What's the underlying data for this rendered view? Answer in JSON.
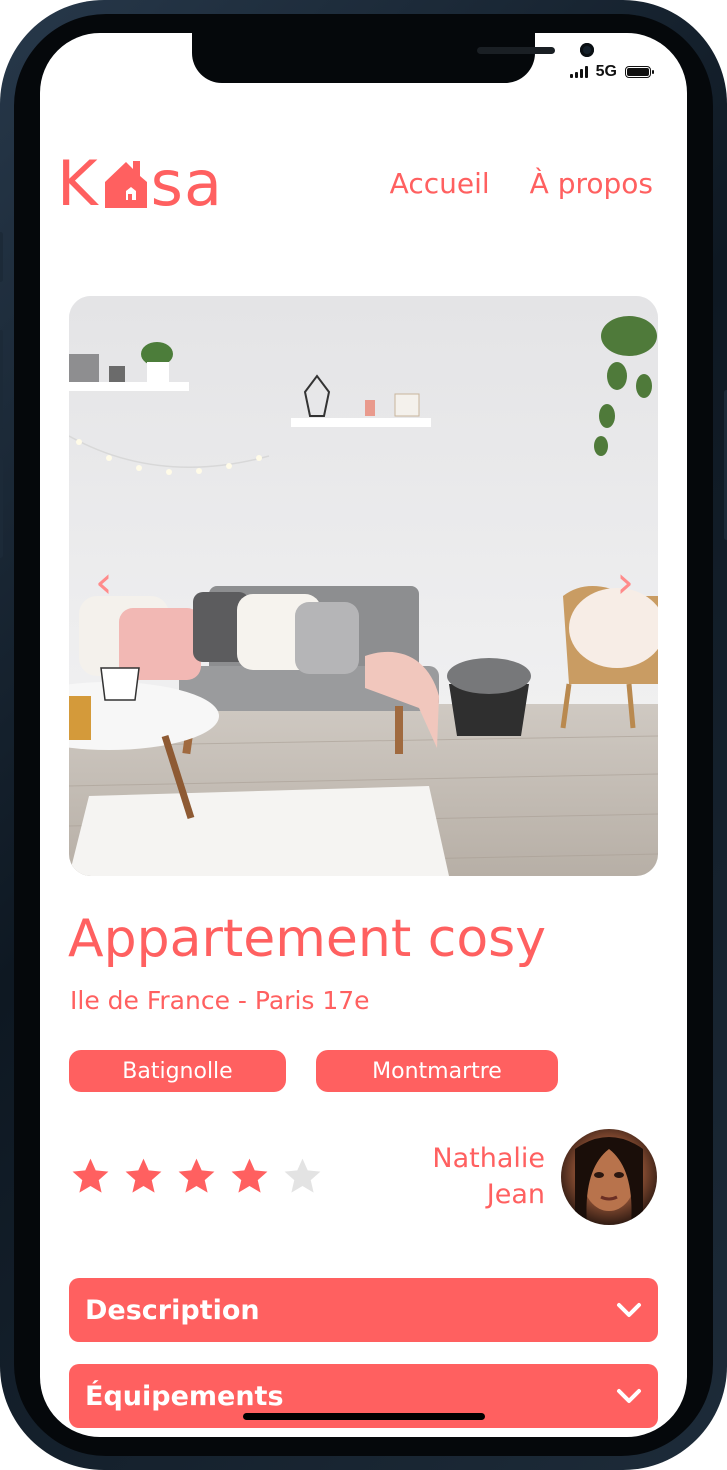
{
  "status_bar": {
    "network": "5G"
  },
  "header": {
    "logo_left": "K",
    "logo_right": "sa",
    "nav": [
      {
        "label": "Accueil"
      },
      {
        "label": "À propos"
      }
    ]
  },
  "gallery": {
    "prev_icon": "‹",
    "next_icon": "›"
  },
  "listing": {
    "title": "Appartement cosy",
    "location": "Ile de France - Paris 17e",
    "tags": [
      "Batignolle",
      "Montmartre"
    ],
    "rating": 4,
    "rating_max": 5,
    "host": {
      "first_name": "Nathalie",
      "last_name": "Jean"
    }
  },
  "sections": [
    {
      "label": "Description"
    },
    {
      "label": "Équipements"
    }
  ],
  "colors": {
    "accent": "#FF6060",
    "star_inactive": "#E3E3E3",
    "arrow": "#ff8b8b"
  }
}
